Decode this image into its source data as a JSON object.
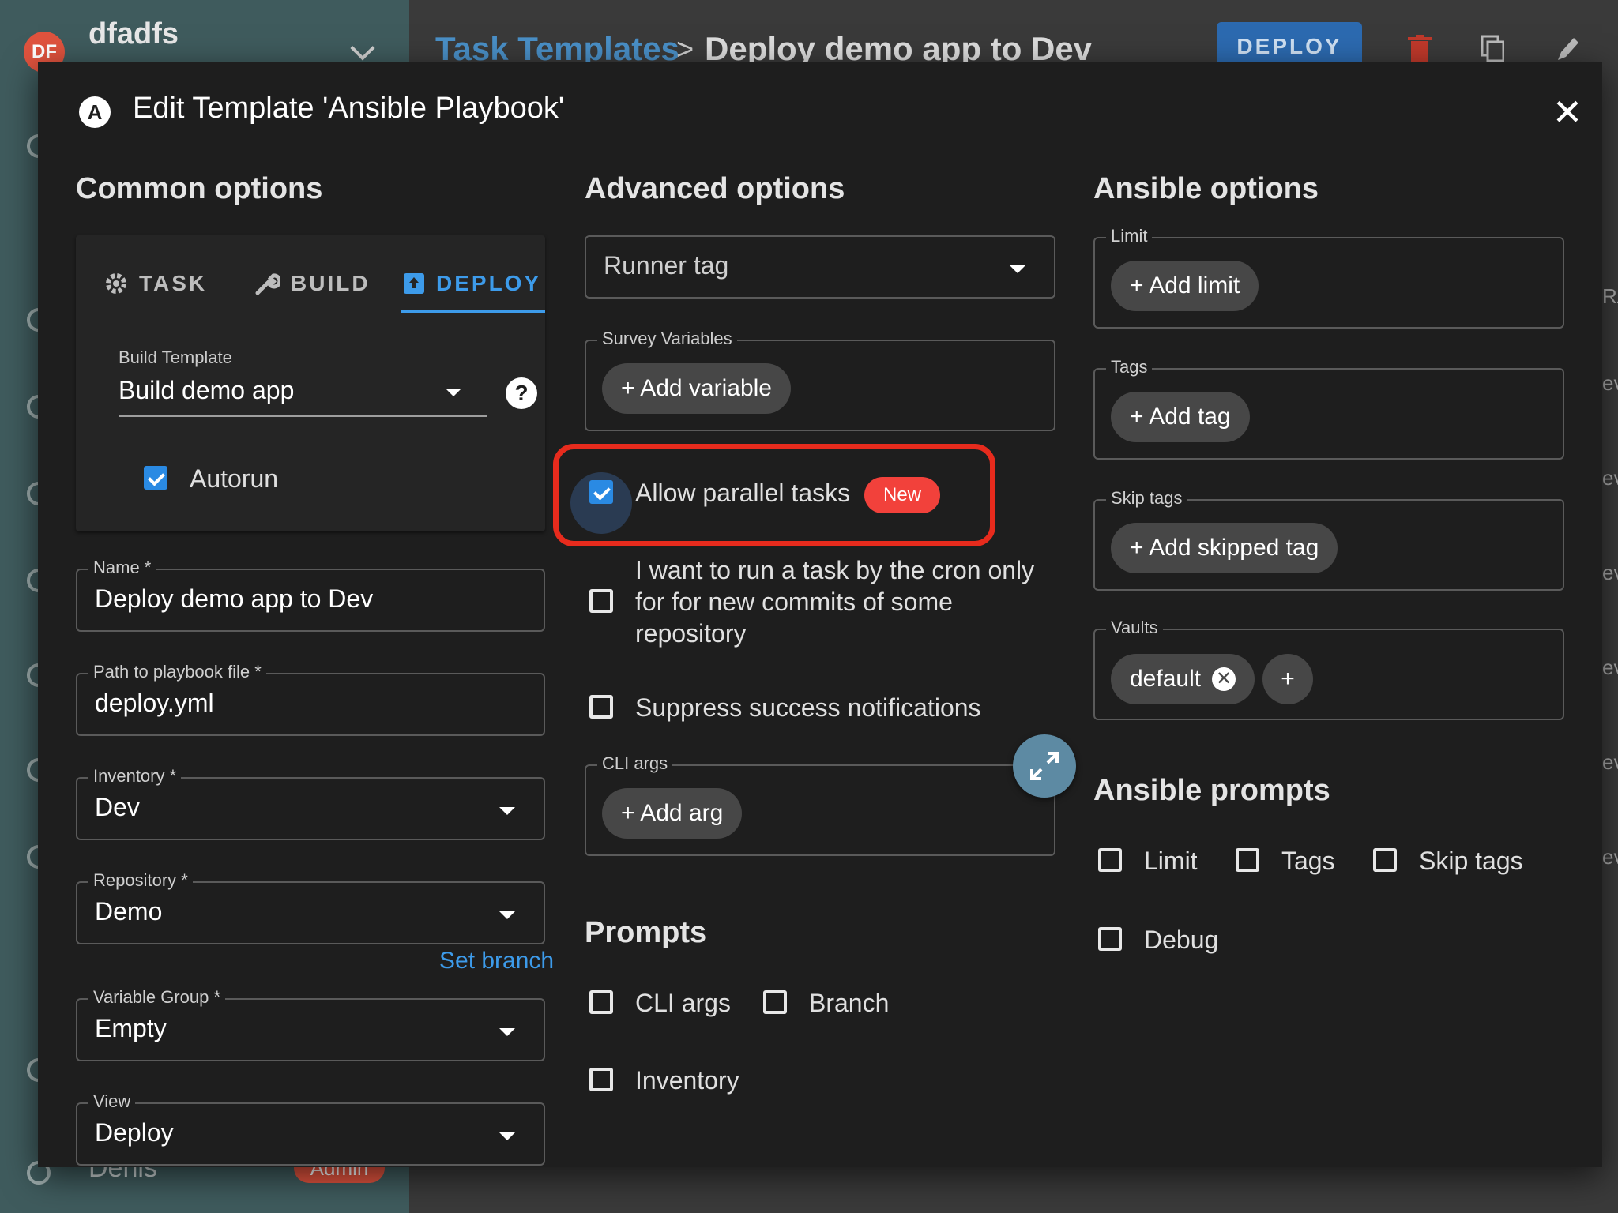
{
  "app": {
    "project_avatar": "DF",
    "project_name": "dfadfs",
    "user_name": "Denis",
    "user_badge": "Admin"
  },
  "header": {
    "breadcrumb_link": "Task Templates",
    "breadcrumb_separator": ">",
    "breadcrumb_current": "Deploy demo app to Dev",
    "deploy_button": "DEPLOY"
  },
  "background_right_column": [
    "RA",
    "ev",
    "ev",
    "ev",
    "ev",
    "ev",
    "ev"
  ],
  "dialog": {
    "title": "Edit Template 'Ansible Playbook'",
    "logo": "A",
    "close": "✕"
  },
  "common": {
    "heading": "Common options",
    "tabs": [
      {
        "label": "TASK",
        "icon": "gear-icon"
      },
      {
        "label": "BUILD",
        "icon": "wrench-icon"
      },
      {
        "label": "DEPLOY",
        "icon": "deploy-icon",
        "active": true
      }
    ],
    "build_template": {
      "label": "Build Template",
      "value": "Build demo app"
    },
    "autorun": {
      "label": "Autorun",
      "checked": true
    },
    "name": {
      "label": "Name *",
      "value": "Deploy demo app to Dev"
    },
    "playbook": {
      "label": "Path to playbook file *",
      "value": "deploy.yml"
    },
    "inventory": {
      "label": "Inventory *",
      "value": "Dev"
    },
    "repository": {
      "label": "Repository *",
      "value": "Demo"
    },
    "set_branch": "Set branch",
    "variable_group": {
      "label": "Variable Group *",
      "value": "Empty"
    },
    "view": {
      "label": "View",
      "value": "Deploy"
    }
  },
  "advanced": {
    "heading": "Advanced options",
    "runner_tag": {
      "placeholder": "Runner tag"
    },
    "survey": {
      "label": "Survey Variables",
      "add": "+ Add variable"
    },
    "parallel": {
      "label": "Allow parallel tasks",
      "badge": "New",
      "checked": true
    },
    "cron_only": {
      "line1": "I want to run a task by the cron only",
      "line2": "for for new commits of some",
      "line3": "repository",
      "checked": false
    },
    "suppress": {
      "label": "Suppress success notifications",
      "checked": false
    },
    "cli_args": {
      "label": "CLI args",
      "add": "+ Add arg"
    }
  },
  "prompts": {
    "heading": "Prompts",
    "cli_args": "CLI args",
    "branch": "Branch",
    "inventory": "Inventory"
  },
  "ansible": {
    "heading": "Ansible options",
    "limit": {
      "label": "Limit",
      "add": "+ Add limit"
    },
    "tags": {
      "label": "Tags",
      "add": "+ Add tag"
    },
    "skip_tags": {
      "label": "Skip tags",
      "add": "+ Add skipped tag"
    },
    "vaults": {
      "label": "Vaults",
      "chip": "default",
      "add": "+"
    }
  },
  "ansible_prompts": {
    "heading": "Ansible prompts",
    "limit": "Limit",
    "tags": "Tags",
    "skip_tags": "Skip tags",
    "debug": "Debug"
  }
}
